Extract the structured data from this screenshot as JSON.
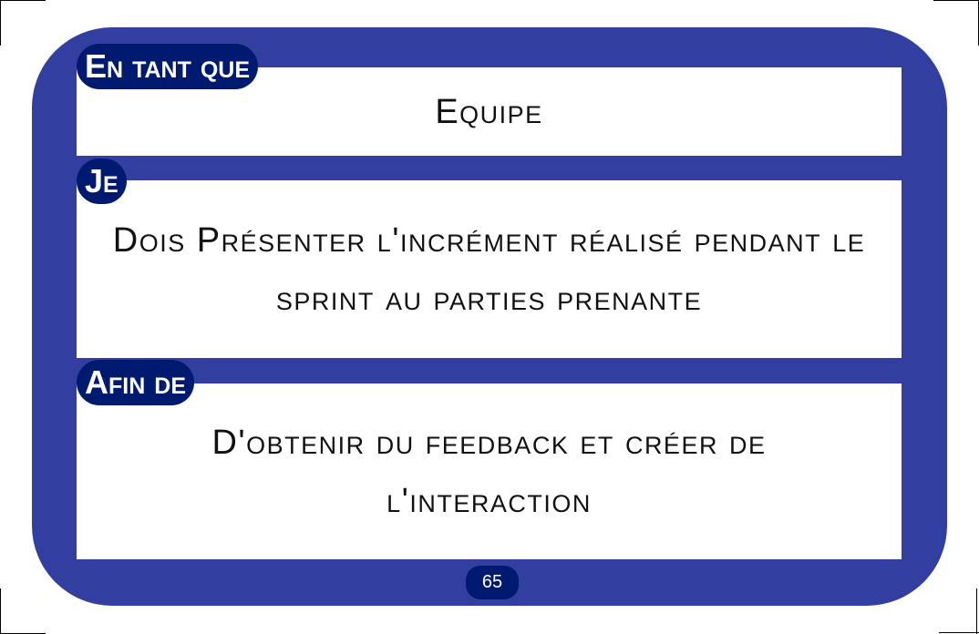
{
  "card": {
    "sections": [
      {
        "label": "En tant que",
        "text": "Equipe"
      },
      {
        "label": "Je",
        "text": "Dois Présenter l'incrément réalisé pendant le sprint au parties prenante"
      },
      {
        "label": "Afin de",
        "text": "D'obtenir du feedback et créer de l'interaction"
      }
    ],
    "page_number": "65"
  },
  "colors": {
    "frame": "#323fa0",
    "label_bg": "#001a70",
    "box_bg": "#ffffff"
  }
}
